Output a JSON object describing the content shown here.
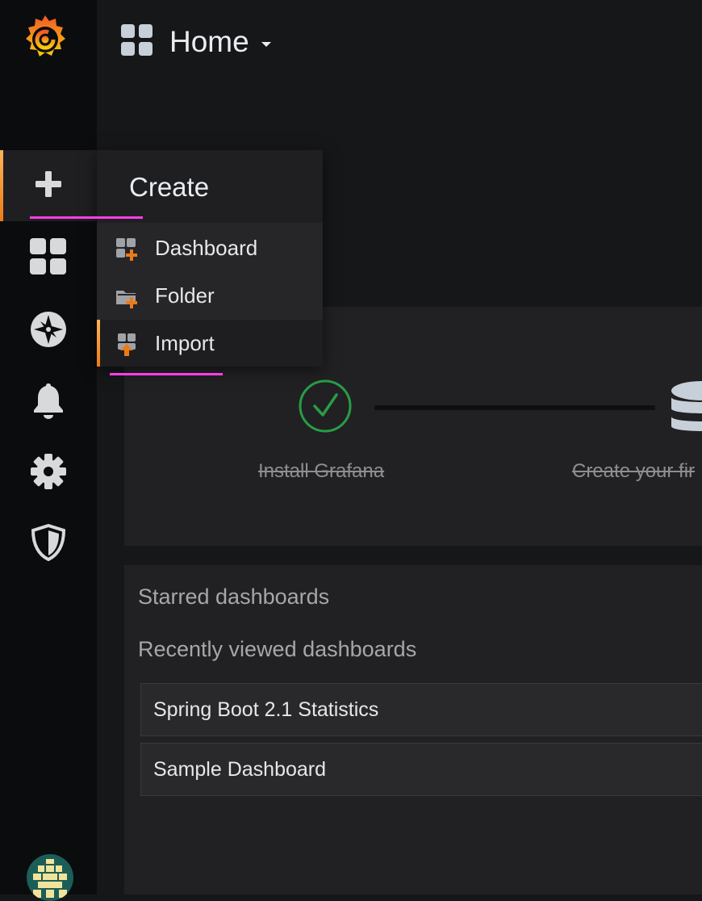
{
  "header": {
    "title": "Home"
  },
  "create_menu": {
    "header": "Create",
    "items": [
      {
        "label": "Dashboard",
        "icon": "dashboard-add-icon"
      },
      {
        "label": "Folder",
        "icon": "folder-add-icon"
      },
      {
        "label": "Import",
        "icon": "import-icon",
        "active": true
      }
    ]
  },
  "sidebar": {
    "items": [
      {
        "name": "create",
        "icon": "plus-icon",
        "active": true
      },
      {
        "name": "dashboards",
        "icon": "dashboards-icon"
      },
      {
        "name": "explore",
        "icon": "compass-icon"
      },
      {
        "name": "alerting",
        "icon": "bell-icon"
      },
      {
        "name": "configuration",
        "icon": "gear-icon"
      },
      {
        "name": "server-admin",
        "icon": "shield-icon"
      }
    ]
  },
  "getting_started": {
    "steps": [
      {
        "label": "Install Grafana",
        "done": true
      },
      {
        "label": "Create your fir",
        "done": true
      }
    ]
  },
  "dashboards": {
    "starred_title": "Starred dashboards",
    "recent_title": "Recently viewed dashboards",
    "recent": [
      "Spring Boot 2.1 Statistics",
      "Sample Dashboard"
    ]
  },
  "colors": {
    "accent": "#eb7b18",
    "success": "#299c46",
    "annotation": "#ff3ee8"
  }
}
